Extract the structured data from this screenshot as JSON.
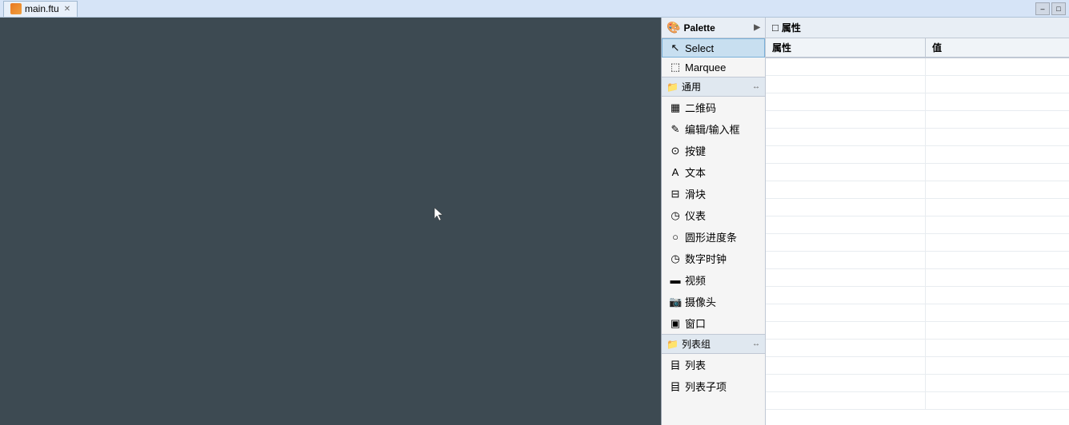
{
  "topbar": {
    "tab_label": "main.ftu",
    "close_char": "✕",
    "win_minimize": "–",
    "win_restore": "□"
  },
  "palette": {
    "header_label": "Palette",
    "chevron": "▶",
    "select_label": "Select",
    "marquee_label": "Marquee",
    "sections": [
      {
        "id": "general",
        "label": "通用",
        "expand_icon": "↔",
        "items": [
          {
            "id": "qrcode",
            "label": "二维码",
            "icon": "▦"
          },
          {
            "id": "editor",
            "label": "编辑/输入框",
            "icon": "✎"
          },
          {
            "id": "button",
            "label": "按键",
            "icon": "⊙"
          },
          {
            "id": "text",
            "label": "文本",
            "icon": "A"
          },
          {
            "id": "slider",
            "label": "滑块",
            "icon": "⊟"
          },
          {
            "id": "gauge",
            "label": "仪表",
            "icon": "◷"
          },
          {
            "id": "circle",
            "label": "圆形进度条",
            "icon": "○"
          },
          {
            "id": "clock",
            "label": "数字时钟",
            "icon": "◷"
          },
          {
            "id": "video",
            "label": "视频",
            "icon": "▬"
          },
          {
            "id": "camera",
            "label": "摄像头",
            "icon": "📷"
          },
          {
            "id": "window",
            "label": "窗口",
            "icon": "▣"
          }
        ]
      },
      {
        "id": "list-group",
        "label": "列表组",
        "expand_icon": "↔",
        "items": [
          {
            "id": "list",
            "label": "列表",
            "icon": "目"
          },
          {
            "id": "list-item",
            "label": "列表子项",
            "icon": "目"
          }
        ]
      }
    ]
  },
  "properties": {
    "title": "属性",
    "title_icon": "□",
    "columns": [
      "属性",
      "值"
    ],
    "rows": [
      {
        "prop": "",
        "value": ""
      },
      {
        "prop": "",
        "value": ""
      },
      {
        "prop": "",
        "value": ""
      },
      {
        "prop": "",
        "value": ""
      },
      {
        "prop": "",
        "value": ""
      },
      {
        "prop": "",
        "value": ""
      },
      {
        "prop": "",
        "value": ""
      },
      {
        "prop": "",
        "value": ""
      },
      {
        "prop": "",
        "value": ""
      },
      {
        "prop": "",
        "value": ""
      },
      {
        "prop": "",
        "value": ""
      },
      {
        "prop": "",
        "value": ""
      },
      {
        "prop": "",
        "value": ""
      },
      {
        "prop": "",
        "value": ""
      }
    ]
  }
}
